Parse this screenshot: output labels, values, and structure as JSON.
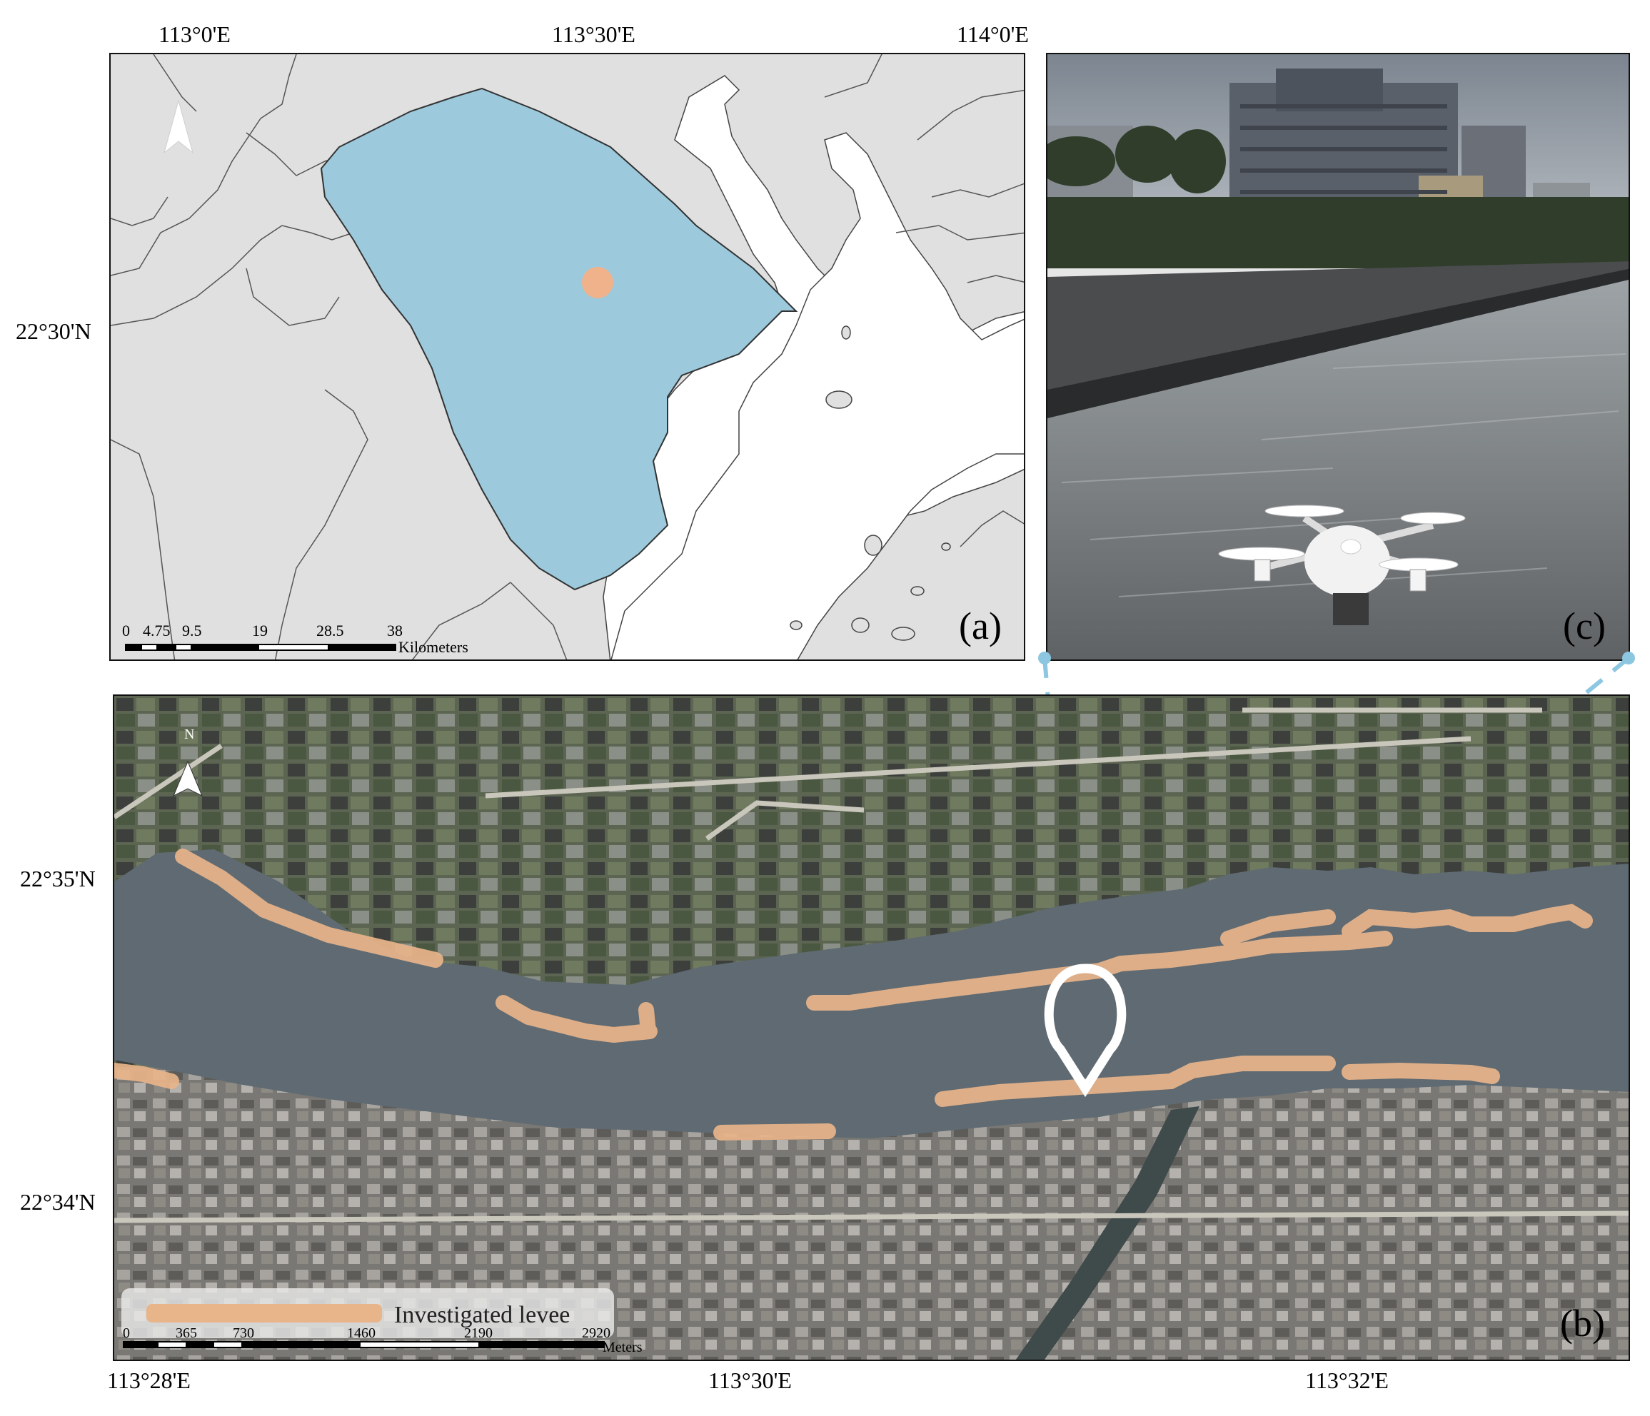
{
  "figure": {
    "panel_a": {
      "letter": "(a)",
      "lon_ticks": [
        "113°0'E",
        "113°30'E",
        "114°0'E"
      ],
      "lat_ticks": [
        "22°30'N"
      ],
      "scale_ticks": [
        "0",
        "4.75",
        "9.5",
        "19",
        "28.5",
        "38"
      ],
      "scale_unit": "Kilometers",
      "colors": {
        "land": "#e0e0e0",
        "sea": "#ffffff",
        "study_region": "#9cc9dc",
        "site": "#f0b28a",
        "border": "#555555"
      },
      "north_arrow": "north-arrow-icon"
    },
    "panel_b": {
      "letter": "(b)",
      "lon_ticks": [
        "113°28'E",
        "113°30'E",
        "113°32'E"
      ],
      "lat_ticks": [
        "22°35'N",
        "22°34'N"
      ],
      "north_label": "N",
      "legend_label": "Investigated levee",
      "scale_ticks": [
        "0",
        "365",
        "730",
        "1460",
        "2190",
        "2920"
      ],
      "scale_unit": "Meters",
      "colors": {
        "river": "#5f6a72",
        "levee": "#e8b48a",
        "connector": "#8cc6e0",
        "marker": "#ffffff"
      },
      "marker": "location-pin-icon"
    },
    "panel_c": {
      "letter": "(c)",
      "content": "drone-photo",
      "drone_icon": "drone-icon"
    }
  }
}
